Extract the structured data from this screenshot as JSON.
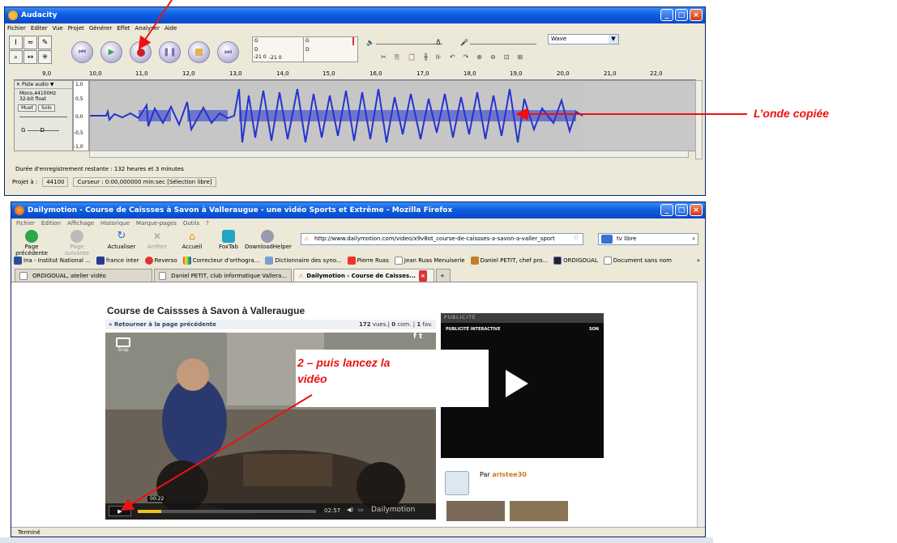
{
  "audacity": {
    "title": "Audacity",
    "menu": [
      "Fichier",
      "Editer",
      "Vue",
      "Projet",
      "Générer",
      "Effet",
      "Analyser",
      "Aide"
    ],
    "meter_labels": [
      "G",
      "D"
    ],
    "meter_scale": "-21 0",
    "wave_select": "Wave",
    "ruler_ticks": [
      "9,0",
      "10,0",
      "11,0",
      "12,0",
      "13,0",
      "14,0",
      "15,0",
      "16,0",
      "17,0",
      "18,0",
      "19,0",
      "20,0",
      "21,0",
      "22,0"
    ],
    "track": {
      "name": "Piste audio",
      "rate": "Mono,44100Hz",
      "format": "32-bit float",
      "mute": "Muet",
      "solo": "Solo",
      "pan_left": "G",
      "pan_right": "D",
      "scale": [
        "1,0",
        "0,5",
        "0,0",
        "-0,5",
        "-1,0"
      ]
    },
    "status_remaining": "Durée d'enregistrement restante : 132 heures et 3 minutes",
    "project_rate_label": "Projet à :",
    "project_rate": "44100",
    "cursor": "Curseur : 0:00,000000 min:sec  [Sélection libre]"
  },
  "firefox": {
    "title": "Dailymotion - Course de Caissses à Savon à Valleraugue - une vidéo Sports et Extrême - Mozilla Firefox",
    "menu": [
      "Fichier",
      "Édition",
      "Affichage",
      "Historique",
      "Marque-pages",
      "Outils",
      "?"
    ],
    "nav": [
      "Page précédente",
      "Page suivante",
      "Actualiser",
      "Arrêter",
      "Accueil",
      "FoxTab",
      "DownloadHelper"
    ],
    "url": "http://www.dailymotion.com/video/x9v8ot_course-de-caissses-a-savon-a-valler_sport",
    "search": "tv libre",
    "bookmarks": [
      "Ina - Institut National ...",
      "france inter",
      "Reverso",
      "Correcteur d'orthogra...",
      "Dictionnaire des syno...",
      "Pierre Ruas",
      "Jean Ruas Menuiserie",
      "Daniel PETIT, chef pro...",
      "ORDIGOUAL",
      "Document sans nom"
    ],
    "tabs": [
      "ORDIGOUAL, atelier vidéo",
      "Daniel PETIT, club informatique Vallera...",
      "Dailymotion - Course de Caisses..."
    ],
    "status": "Terminé"
  },
  "page": {
    "video_title": "Course de Caissses à Savon à Valleraugue",
    "back_link": "« Retourner à la page précédente",
    "views": "172",
    "views_label": "vues.|",
    "comments": "0",
    "comments_label": "com. |",
    "favs": "1",
    "favs_label": "fav.",
    "snap": "Snip",
    "current_time": "00:22",
    "total_time": "02:57",
    "brand": "Dailymotion",
    "pub_header": "PUBLICITÉ",
    "pub_sub": "PUBLICITÉ INTERACTIVE",
    "pub_son": "SON",
    "author_prefix": "Par",
    "author": "aristee30"
  },
  "annotations": {
    "wave_label": "L’onde copiée",
    "callout_line1": "2 – puis lancez la",
    "callout_line2": "vidéo"
  },
  "colors": {
    "xp_blue": "#0d5ee0",
    "waveform": "#2434d0",
    "annotation": "#e11111",
    "record_red": "#cc2222",
    "play_green": "#2fa84a"
  }
}
